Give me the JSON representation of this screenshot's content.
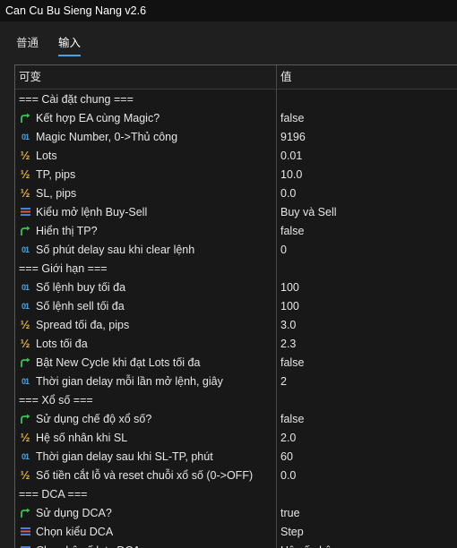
{
  "window": {
    "title": "Can Cu Bu Sieng Nang v2.6"
  },
  "tabs": [
    {
      "label": "普通",
      "active": false
    },
    {
      "label": "输入",
      "active": true
    }
  ],
  "table": {
    "headers": {
      "variable": "可变",
      "value": "值"
    },
    "rows": [
      {
        "type": "section",
        "label": "=== Cài đặt chung ===",
        "value": ""
      },
      {
        "type": "bool",
        "icon": "bool-arrow-icon",
        "label": "Kết hợp EA cùng Magic?",
        "value": "false"
      },
      {
        "type": "int",
        "icon": "int-icon",
        "label": "Magic Number, 0->Thủ công",
        "value": "9196"
      },
      {
        "type": "double",
        "icon": "double-icon",
        "label": "Lots",
        "value": "0.01"
      },
      {
        "type": "double",
        "icon": "double-icon",
        "label": "TP, pips",
        "value": "10.0"
      },
      {
        "type": "double",
        "icon": "double-icon",
        "label": "SL, pips",
        "value": "0.0"
      },
      {
        "type": "enum",
        "icon": "enum-icon",
        "label": "Kiểu mở lệnh Buy-Sell",
        "value": "Buy và Sell"
      },
      {
        "type": "bool",
        "icon": "bool-arrow-icon",
        "label": "Hiển thị TP?",
        "value": "false"
      },
      {
        "type": "int",
        "icon": "int-icon",
        "label": "Số phút delay sau khi clear lệnh",
        "value": "0"
      },
      {
        "type": "section",
        "label": "=== Giới hạn ===",
        "value": ""
      },
      {
        "type": "int",
        "icon": "int-icon",
        "label": "Số lệnh buy tối đa",
        "value": "100"
      },
      {
        "type": "int",
        "icon": "int-icon",
        "label": "Số lệnh sell tối đa",
        "value": "100"
      },
      {
        "type": "double",
        "icon": "double-icon",
        "label": "Spread tối đa, pips",
        "value": "3.0"
      },
      {
        "type": "double",
        "icon": "double-icon",
        "label": "Lots tối đa",
        "value": "2.3"
      },
      {
        "type": "bool",
        "icon": "bool-arrow-icon",
        "label": "Bật New Cycle khi đạt Lots tối đa",
        "value": "false"
      },
      {
        "type": "int",
        "icon": "int-icon",
        "label": "Thời gian delay mỗi lần mở lệnh, giây",
        "value": "2"
      },
      {
        "type": "section",
        "label": "=== Xổ số ===",
        "value": ""
      },
      {
        "type": "bool",
        "icon": "bool-arrow-icon",
        "label": "Sử dụng chế độ xổ số?",
        "value": "false"
      },
      {
        "type": "double",
        "icon": "double-icon",
        "label": "Hệ số nhân khi SL",
        "value": "2.0"
      },
      {
        "type": "int",
        "icon": "int-icon",
        "label": "Thời gian delay sau khi SL-TP, phút",
        "value": "60"
      },
      {
        "type": "double",
        "icon": "double-icon",
        "label": "Số tiền cắt lỗ và reset chuỗi xổ số (0->OFF)",
        "value": "0.0"
      },
      {
        "type": "section",
        "label": "=== DCA ===",
        "value": ""
      },
      {
        "type": "bool",
        "icon": "bool-arrow-icon",
        "label": "Sử dụng DCA?",
        "value": "true"
      },
      {
        "type": "enum",
        "icon": "enum-icon",
        "label": "Chọn kiểu DCA",
        "value": "Step"
      },
      {
        "type": "enum",
        "icon": "enum-icon",
        "label": "Chọn hệ số lots DCA",
        "value": "Hệ số nhân"
      }
    ]
  },
  "colors": {
    "int_icon": "#4aa3e0",
    "double_icon": "#e0b04a",
    "bool_icon": "#3fbf5a",
    "enum_icon_blue": "#4a7fe0",
    "enum_icon_red": "#e05a4a",
    "tab_underline": "#4aa3e0"
  }
}
